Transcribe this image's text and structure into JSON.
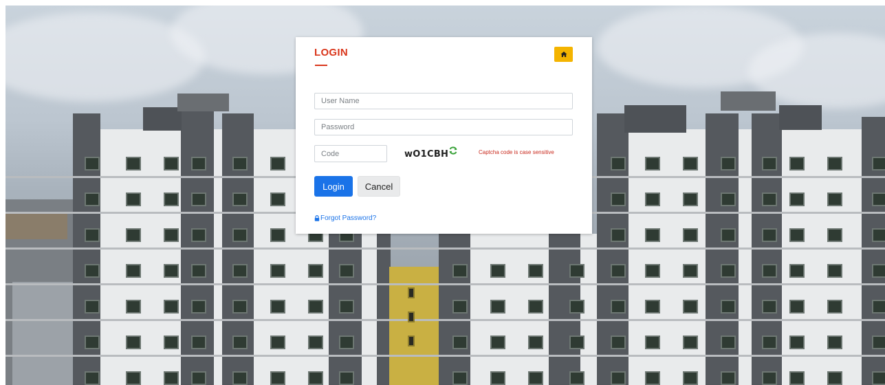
{
  "background": {
    "description_colors": {
      "sky": "#c4ced8",
      "building_wall": "#e9ebec",
      "building_column": "#55595e",
      "window": "#2f3b33"
    }
  },
  "login": {
    "title": "LOGIN",
    "accent_color": "#d9361b",
    "home_button_color": "#f4b400",
    "home_icon": "home-icon",
    "username_placeholder": "User Name",
    "password_placeholder": "Password",
    "code_placeholder": "Code",
    "captcha": "wO1CBH",
    "refresh_icon": "refresh-icon",
    "captcha_note": "Captcha code is case sensitive",
    "login_label": "Login",
    "login_color": "#1a73e8",
    "cancel_label": "Cancel",
    "forgot_label": "Forgot Password?",
    "forgot_icon": "lock-icon"
  }
}
